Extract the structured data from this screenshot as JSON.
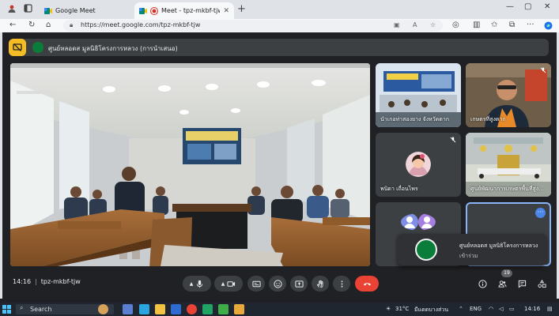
{
  "browser": {
    "tabs": [
      {
        "title": "Google Meet",
        "active": false
      },
      {
        "title": "Meet - tpz-mkbf-tjw",
        "active": true
      }
    ],
    "url": "https://meet.google.com/tpz-mkbf-tjw"
  },
  "meet": {
    "presenter_banner": "ศูนย์หลอดส มูลนิธิโครงการหลวง (การนำเสนอ)",
    "tiles": [
      {
        "label": "นำเกอท่าสองยาง จังหวัดตาก",
        "muted": false
      },
      {
        "label": "เกษตรที่สูงตาก",
        "muted": true
      },
      {
        "label": "พนิดา เถื่อนไพร",
        "muted": true
      },
      {
        "label": "ศูนย์พัฒนาการเกษตรพื้นที่สูง...",
        "muted": false
      },
      {
        "label": "",
        "muted": false
      },
      {
        "label": "",
        "muted": false
      }
    ],
    "join_toast": {
      "name": "ศูนย์หลอดส มูลนิธิโครงการหลวง",
      "status": "เข้าร่วม"
    },
    "time": "14:16",
    "code": "tpz-mkbf-tjw",
    "participant_count": "19",
    "more_label": "···"
  },
  "taskbar": {
    "search_placeholder": "Search",
    "weather": "31°C",
    "weather_text": "มีแดดบางส่วน",
    "lang": "ENG",
    "clock": "14:16"
  },
  "colors": {
    "meet_bg": "#202124",
    "control_bg": "#3c4043",
    "end_call": "#ea4335",
    "record_badge": "#f4bd25",
    "active_border": "#8ab4f8"
  }
}
